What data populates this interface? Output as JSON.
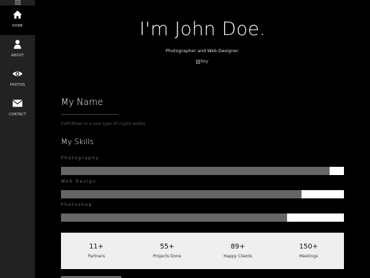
{
  "sidebar": {
    "items": [
      {
        "label": "HOME",
        "icon": "home-icon"
      },
      {
        "label": "ABOUT",
        "icon": "user-icon"
      },
      {
        "label": "PHOTOS",
        "icon": "eye-icon"
      },
      {
        "label": "CONTACT",
        "icon": "envelope-icon"
      }
    ]
  },
  "hero": {
    "title": "I'm John Doe.",
    "subtitle": "Photographer and Web Designer.",
    "image_alt": "boy"
  },
  "about": {
    "name_heading": "My Name",
    "description": "EVRYMiner is a new type of crypto wallet.",
    "skills_heading": "My Skills"
  },
  "skills": [
    {
      "label": "Photography",
      "percent": 95
    },
    {
      "label": "Web Design",
      "percent": 85
    },
    {
      "label": "Photoshop",
      "percent": 80
    }
  ],
  "stats": [
    {
      "value": "11+",
      "label": "Partners"
    },
    {
      "value": "55+",
      "label": "Projects Done"
    },
    {
      "value": "89+",
      "label": "Happy Clients"
    },
    {
      "value": "150+",
      "label": "Meetings"
    }
  ],
  "colors": {
    "background": "#000000",
    "sidebar": "#222222",
    "bar_fill": "#666666",
    "bar_track": "#ffffff",
    "stats_bg": "#efefef"
  }
}
